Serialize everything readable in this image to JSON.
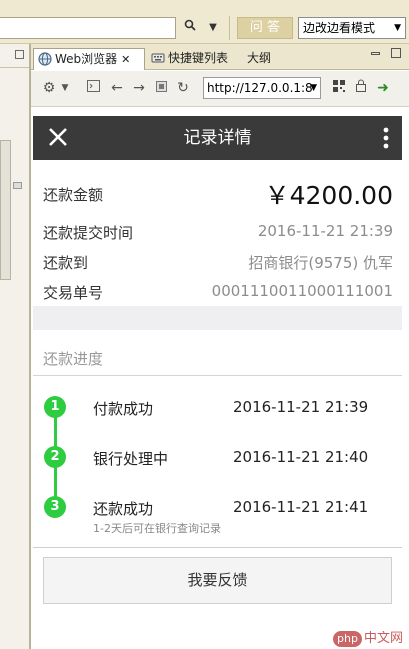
{
  "topbar": {
    "search_icon": "search-icon",
    "dropdown_icon": "chevron-down-icon",
    "ask_button": "问 答",
    "mode_select": "边改边看模式"
  },
  "tabs": [
    {
      "label": "Web浏览器",
      "icon": "globe-icon",
      "active": true
    },
    {
      "label": "快捷键列表",
      "icon": "keyboard-icon",
      "active": false
    },
    {
      "label": "大纲",
      "icon": "",
      "active": false
    }
  ],
  "toolbar": {
    "url": "http://127.0.0.1:8"
  },
  "app": {
    "title": "记录详情",
    "amount_label": "还款金额",
    "amount_value": "￥4200.00",
    "rows": [
      {
        "label": "还款提交时间",
        "value": "2016-11-21 21:39"
      },
      {
        "label": "还款到",
        "value": "招商银行(9575) 仇军"
      },
      {
        "label": "交易单号",
        "value": "0001110011000111001"
      }
    ],
    "progress_title": "还款进度",
    "steps": [
      {
        "num": "1",
        "label": "付款成功",
        "time": "2016-11-21 21:39",
        "note": ""
      },
      {
        "num": "2",
        "label": "银行处理中",
        "time": "2016-11-21 21:40",
        "note": ""
      },
      {
        "num": "3",
        "label": "还款成功",
        "time": "2016-11-21 21:41",
        "note": "1-2天后可在银行查询记录"
      }
    ],
    "feedback_button": "我要反馈",
    "accent_color": "#2ecc40",
    "header_color": "#3a3a3a"
  },
  "watermark": {
    "badge": "php",
    "text": "中文网"
  }
}
